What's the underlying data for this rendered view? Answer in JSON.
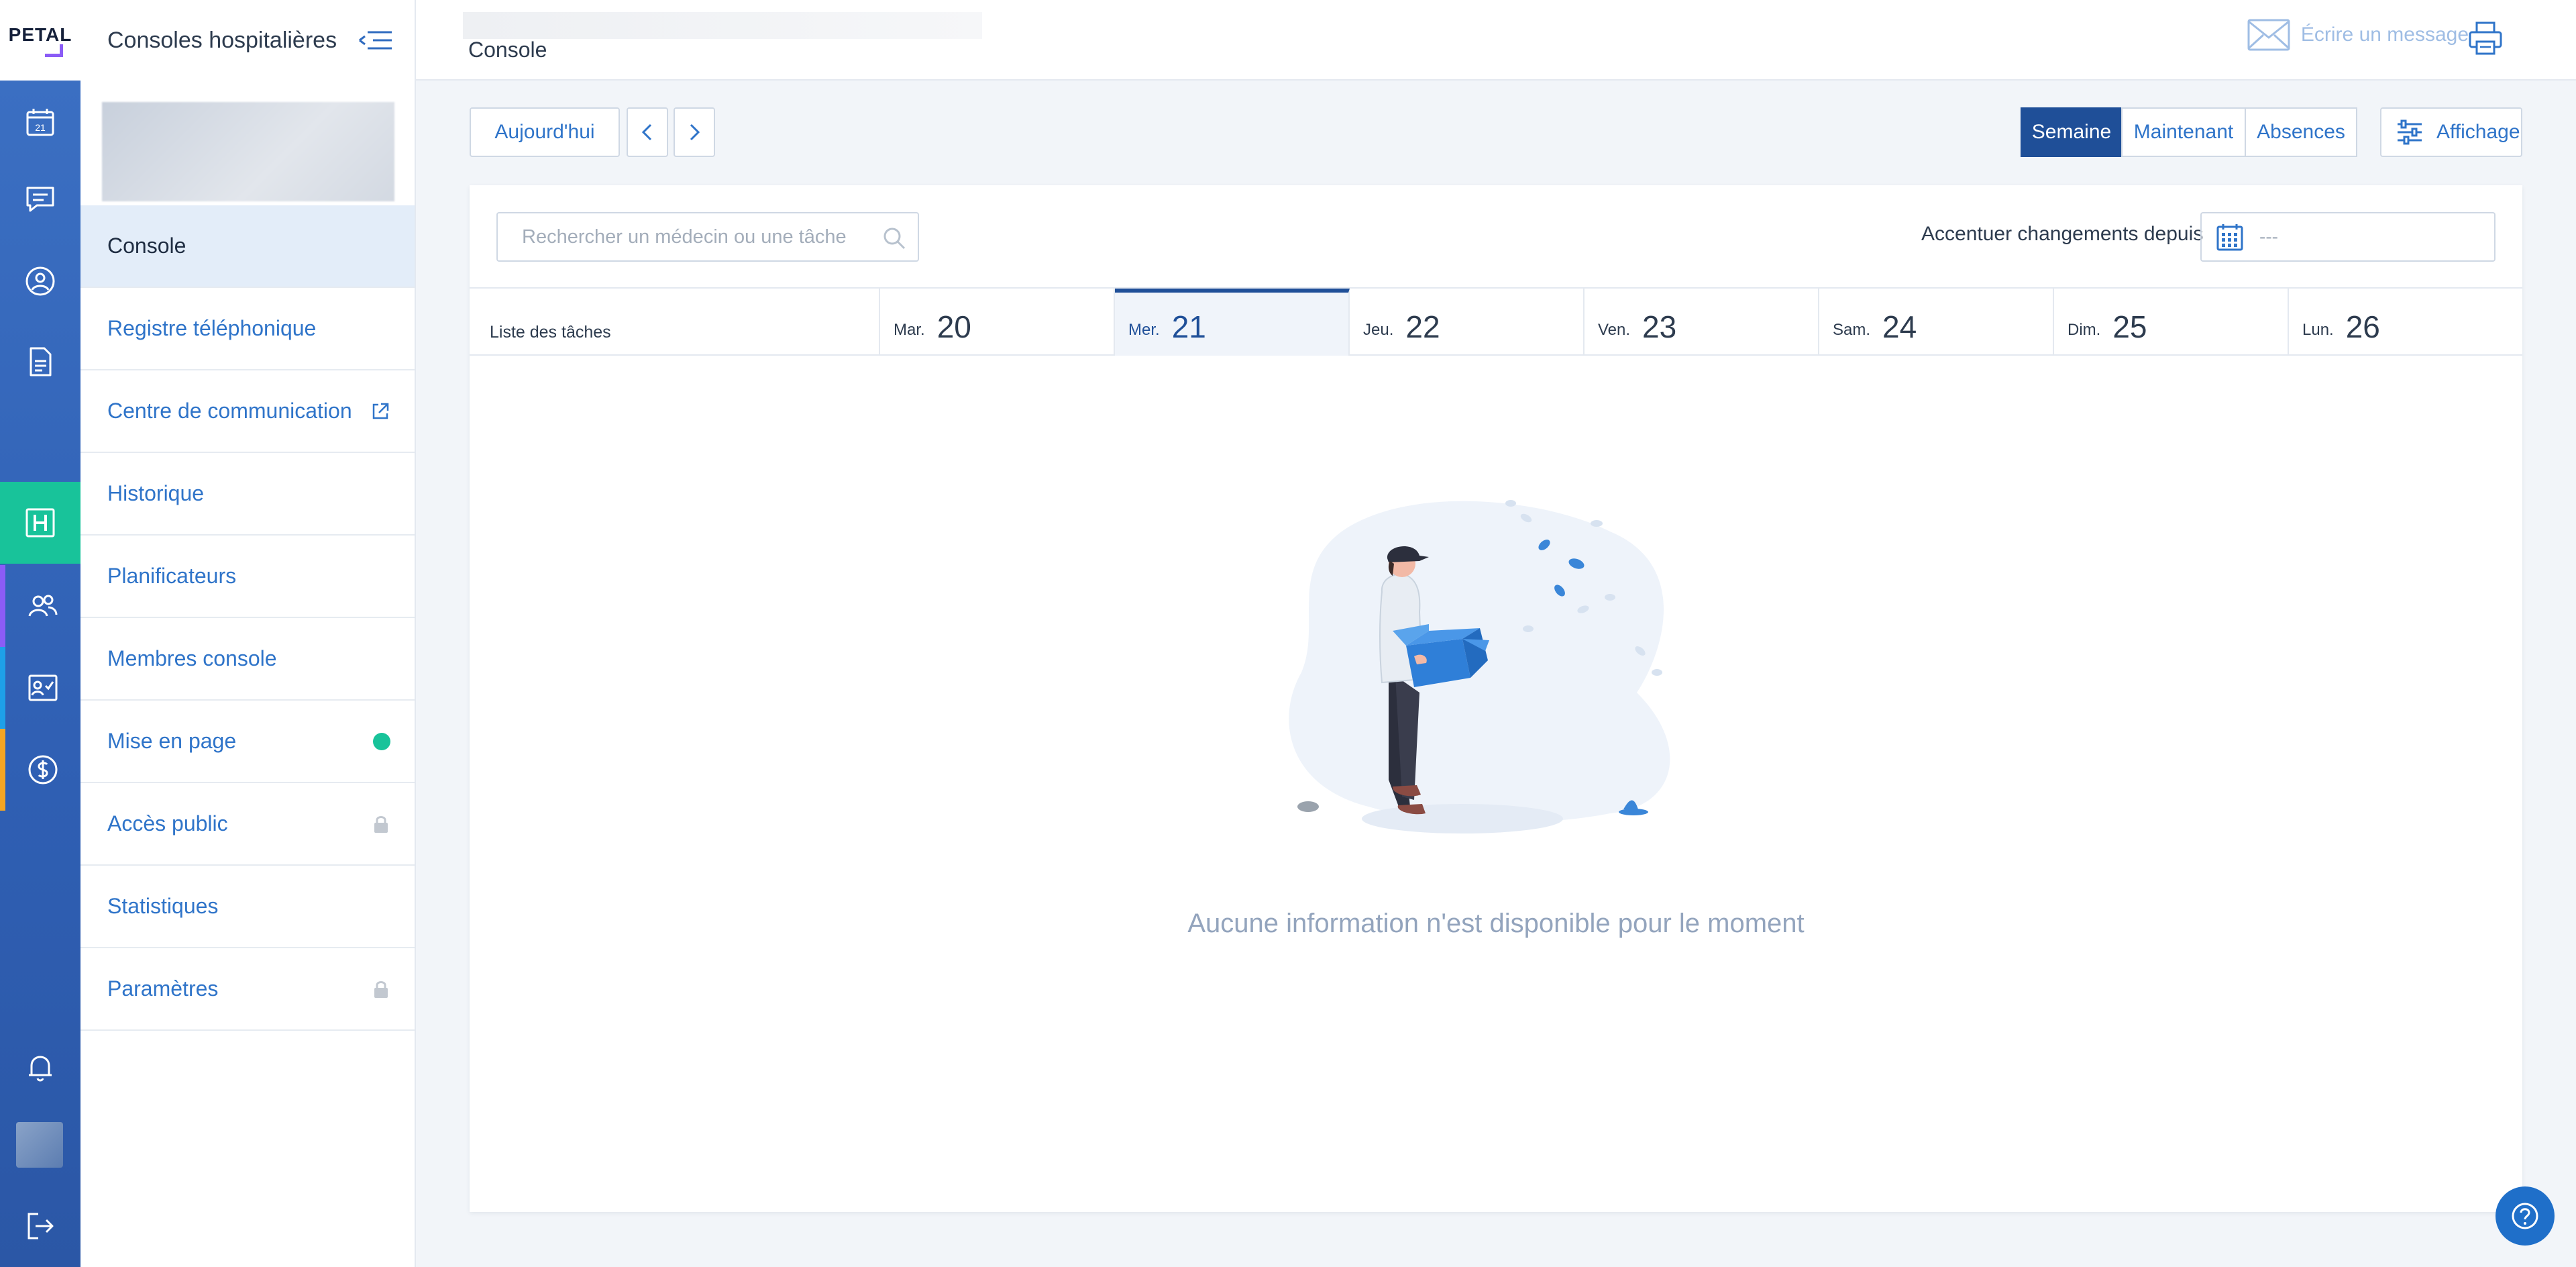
{
  "app": {
    "logo": "PETAL",
    "section_title": "Consoles hospitalières"
  },
  "rail": {
    "calendar_day": "21",
    "items": [
      "calendar-icon",
      "chat-icon",
      "user-circle-icon",
      "document-icon",
      "hospital-icon",
      "team-icon",
      "checklist-icon",
      "dollar-icon",
      "bell-icon",
      "logout-icon"
    ]
  },
  "sidebar": {
    "items": [
      {
        "label": "Console",
        "active": true
      },
      {
        "label": "Registre téléphonique"
      },
      {
        "label": "Centre de communication",
        "trailing": "external-link-icon"
      },
      {
        "label": "Historique"
      },
      {
        "label": "Planificateurs"
      },
      {
        "label": "Membres console"
      },
      {
        "label": "Mise en page",
        "trailing": "status-dot"
      },
      {
        "label": "Accès public",
        "trailing": "lock-icon"
      },
      {
        "label": "Statistiques"
      },
      {
        "label": "Paramètres",
        "trailing": "lock-icon"
      }
    ]
  },
  "header": {
    "title": "Console",
    "message_label": "Écrire un message"
  },
  "toolbar": {
    "today_label": "Aujourd'hui",
    "view_tabs": [
      "Semaine",
      "Maintenant",
      "Absences"
    ],
    "selected_view": "Semaine",
    "display_label": "Affichage"
  },
  "filters": {
    "search_placeholder": "Rechercher un médecin ou une tâche",
    "accent_label": "Accentuer changements depuis",
    "accent_value": "---"
  },
  "calendar": {
    "tasks_header": "Liste des tâches",
    "days": [
      {
        "name": "Mar.",
        "date": "20"
      },
      {
        "name": "Mer.",
        "date": "21",
        "today": true
      },
      {
        "name": "Jeu.",
        "date": "22"
      },
      {
        "name": "Ven.",
        "date": "23"
      },
      {
        "name": "Sam.",
        "date": "24"
      },
      {
        "name": "Dim.",
        "date": "25"
      },
      {
        "name": "Lun.",
        "date": "26"
      }
    ],
    "empty_message": "Aucune information n'est disponible pour le moment"
  },
  "colors": {
    "primary": "#2f74c9",
    "active_tab": "#1f4f98",
    "rail": "#3b6fc2",
    "hospital": "#18c39a",
    "status_dot": "#18c39a"
  }
}
